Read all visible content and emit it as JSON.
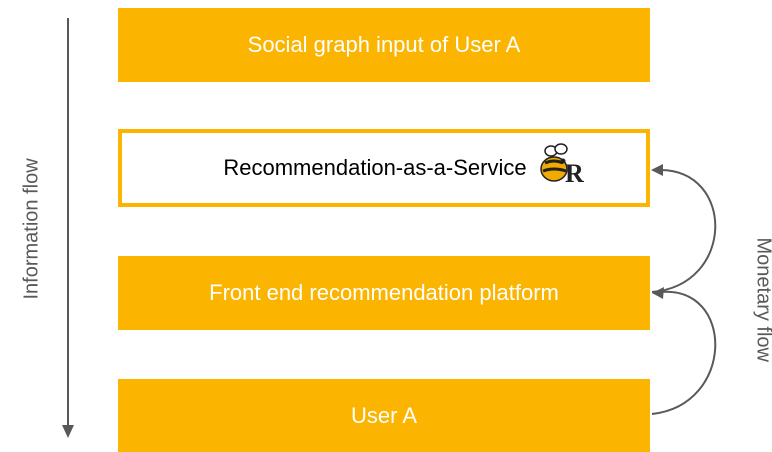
{
  "boxes": {
    "social_input": "Social graph input of User A",
    "raas": "Recommendation-as-a-Service",
    "front_end": "Front end recommendation platform",
    "user": "User A"
  },
  "labels": {
    "information_flow": "Information flow",
    "monetary_flow": "Monetary flow"
  },
  "icons": {
    "raas_logo": "bee-r-logo-icon"
  },
  "colors": {
    "accent": "#FBB400",
    "arrow": "#595959",
    "text_dark": "#000000",
    "text_light": "#FFFFFF"
  }
}
